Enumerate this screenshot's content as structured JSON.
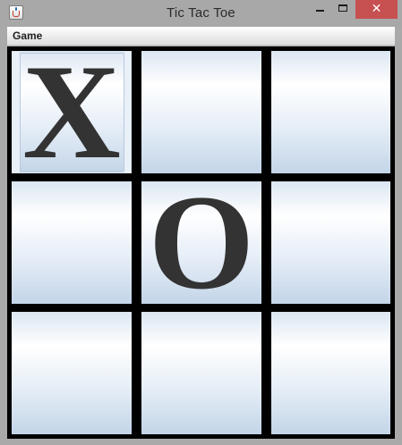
{
  "window": {
    "title": "Tic Tac Toe",
    "close_glyph": "✕"
  },
  "menubar": {
    "items": [
      "Game"
    ]
  },
  "board": {
    "cells": [
      "X",
      "",
      "",
      "",
      "O",
      "",
      "",
      "",
      ""
    ]
  },
  "colors": {
    "mark": "#333333",
    "grid": "#000000",
    "close_button": "#c75050",
    "titlebar": "#a8a8a8"
  }
}
